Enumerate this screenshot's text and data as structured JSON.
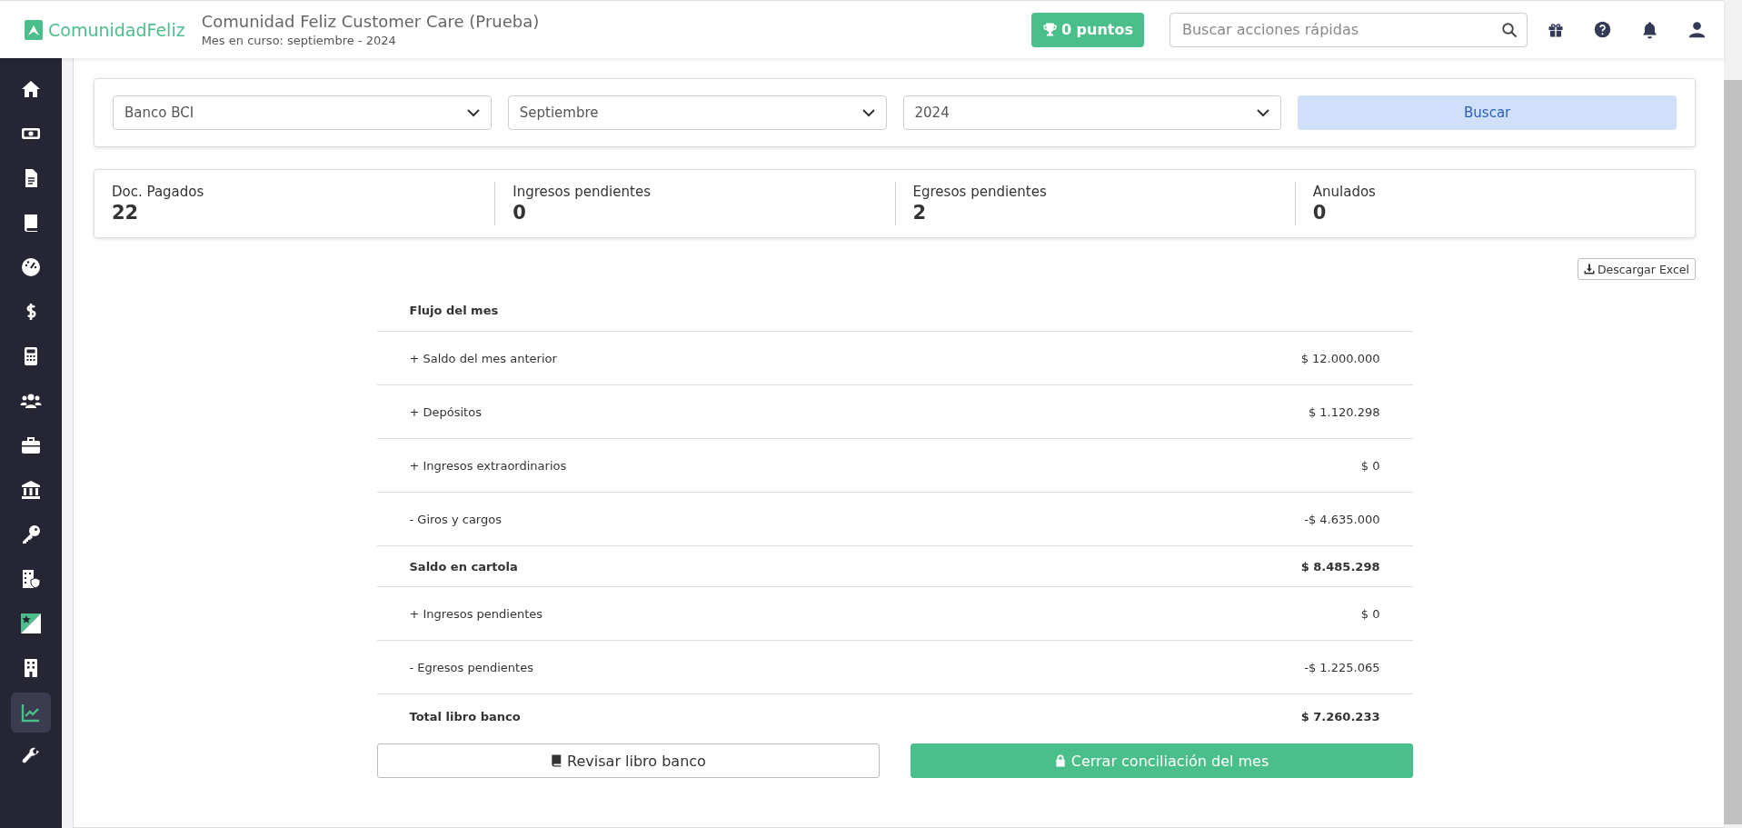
{
  "header": {
    "logo": "ComunidadFeliz",
    "title": "Comunidad Feliz Customer Care (Prueba)",
    "subtitle": "Mes en curso: septiembre - 2024",
    "points": "0 puntos",
    "search": {
      "placeholder": "Buscar acciones rápidas"
    }
  },
  "sidebar": {
    "items": [
      {
        "kind": "home",
        "selected": false
      },
      {
        "kind": "money",
        "selected": false
      },
      {
        "kind": "document",
        "selected": false
      },
      {
        "kind": "book",
        "selected": false
      },
      {
        "kind": "gauge",
        "selected": false
      },
      {
        "kind": "dollar",
        "selected": false
      },
      {
        "kind": "calculator",
        "selected": false
      },
      {
        "kind": "users",
        "selected": false
      },
      {
        "kind": "briefcase",
        "selected": false
      },
      {
        "kind": "bank",
        "selected": false
      },
      {
        "kind": "key",
        "selected": false
      },
      {
        "kind": "building-shield",
        "selected": false
      },
      {
        "kind": "promo",
        "selected": false
      },
      {
        "kind": "building",
        "selected": false
      },
      {
        "kind": "chart",
        "selected": true
      },
      {
        "kind": "wrench",
        "selected": false
      }
    ]
  },
  "filters": {
    "selects": [
      {
        "value": "Banco BCI"
      },
      {
        "value": "Septiembre"
      },
      {
        "value": "2024"
      }
    ],
    "button": "Buscar"
  },
  "stats": [
    {
      "label": "Doc. Pagados",
      "value": "22"
    },
    {
      "label": "Ingresos pendientes",
      "value": "0"
    },
    {
      "label": "Egresos pendientes",
      "value": "2"
    },
    {
      "label": "Anulados",
      "value": "0"
    }
  ],
  "download_button": "Descargar Excel",
  "flow_table": {
    "title": "Flujo del mes",
    "rows": [
      {
        "kind": "item",
        "label": "+ Saldo del mes anterior",
        "amount": "$ 12.000.000"
      },
      {
        "kind": "item",
        "label": "+ Depósitos",
        "amount": "$ 1.120.298"
      },
      {
        "kind": "item",
        "label": "+ Ingresos extraordinarios",
        "amount": "$ 0"
      },
      {
        "kind": "item",
        "label": "- Giros y cargos",
        "amount": "-$ 4.635.000"
      },
      {
        "kind": "total",
        "label": "Saldo en cartola",
        "amount": "$ 8.485.298"
      },
      {
        "kind": "item",
        "label": "+ Ingresos pendientes",
        "amount": "$ 0"
      },
      {
        "kind": "item",
        "label": "- Egresos pendientes",
        "amount": "-$ 1.225.065"
      },
      {
        "kind": "total",
        "label": "Total libro banco",
        "amount": "$ 7.260.233"
      }
    ]
  },
  "actions": [
    {
      "kind": "secondary",
      "label": "Revisar libro banco"
    },
    {
      "kind": "primary",
      "label": "Cerrar conciliación del mes"
    }
  ]
}
